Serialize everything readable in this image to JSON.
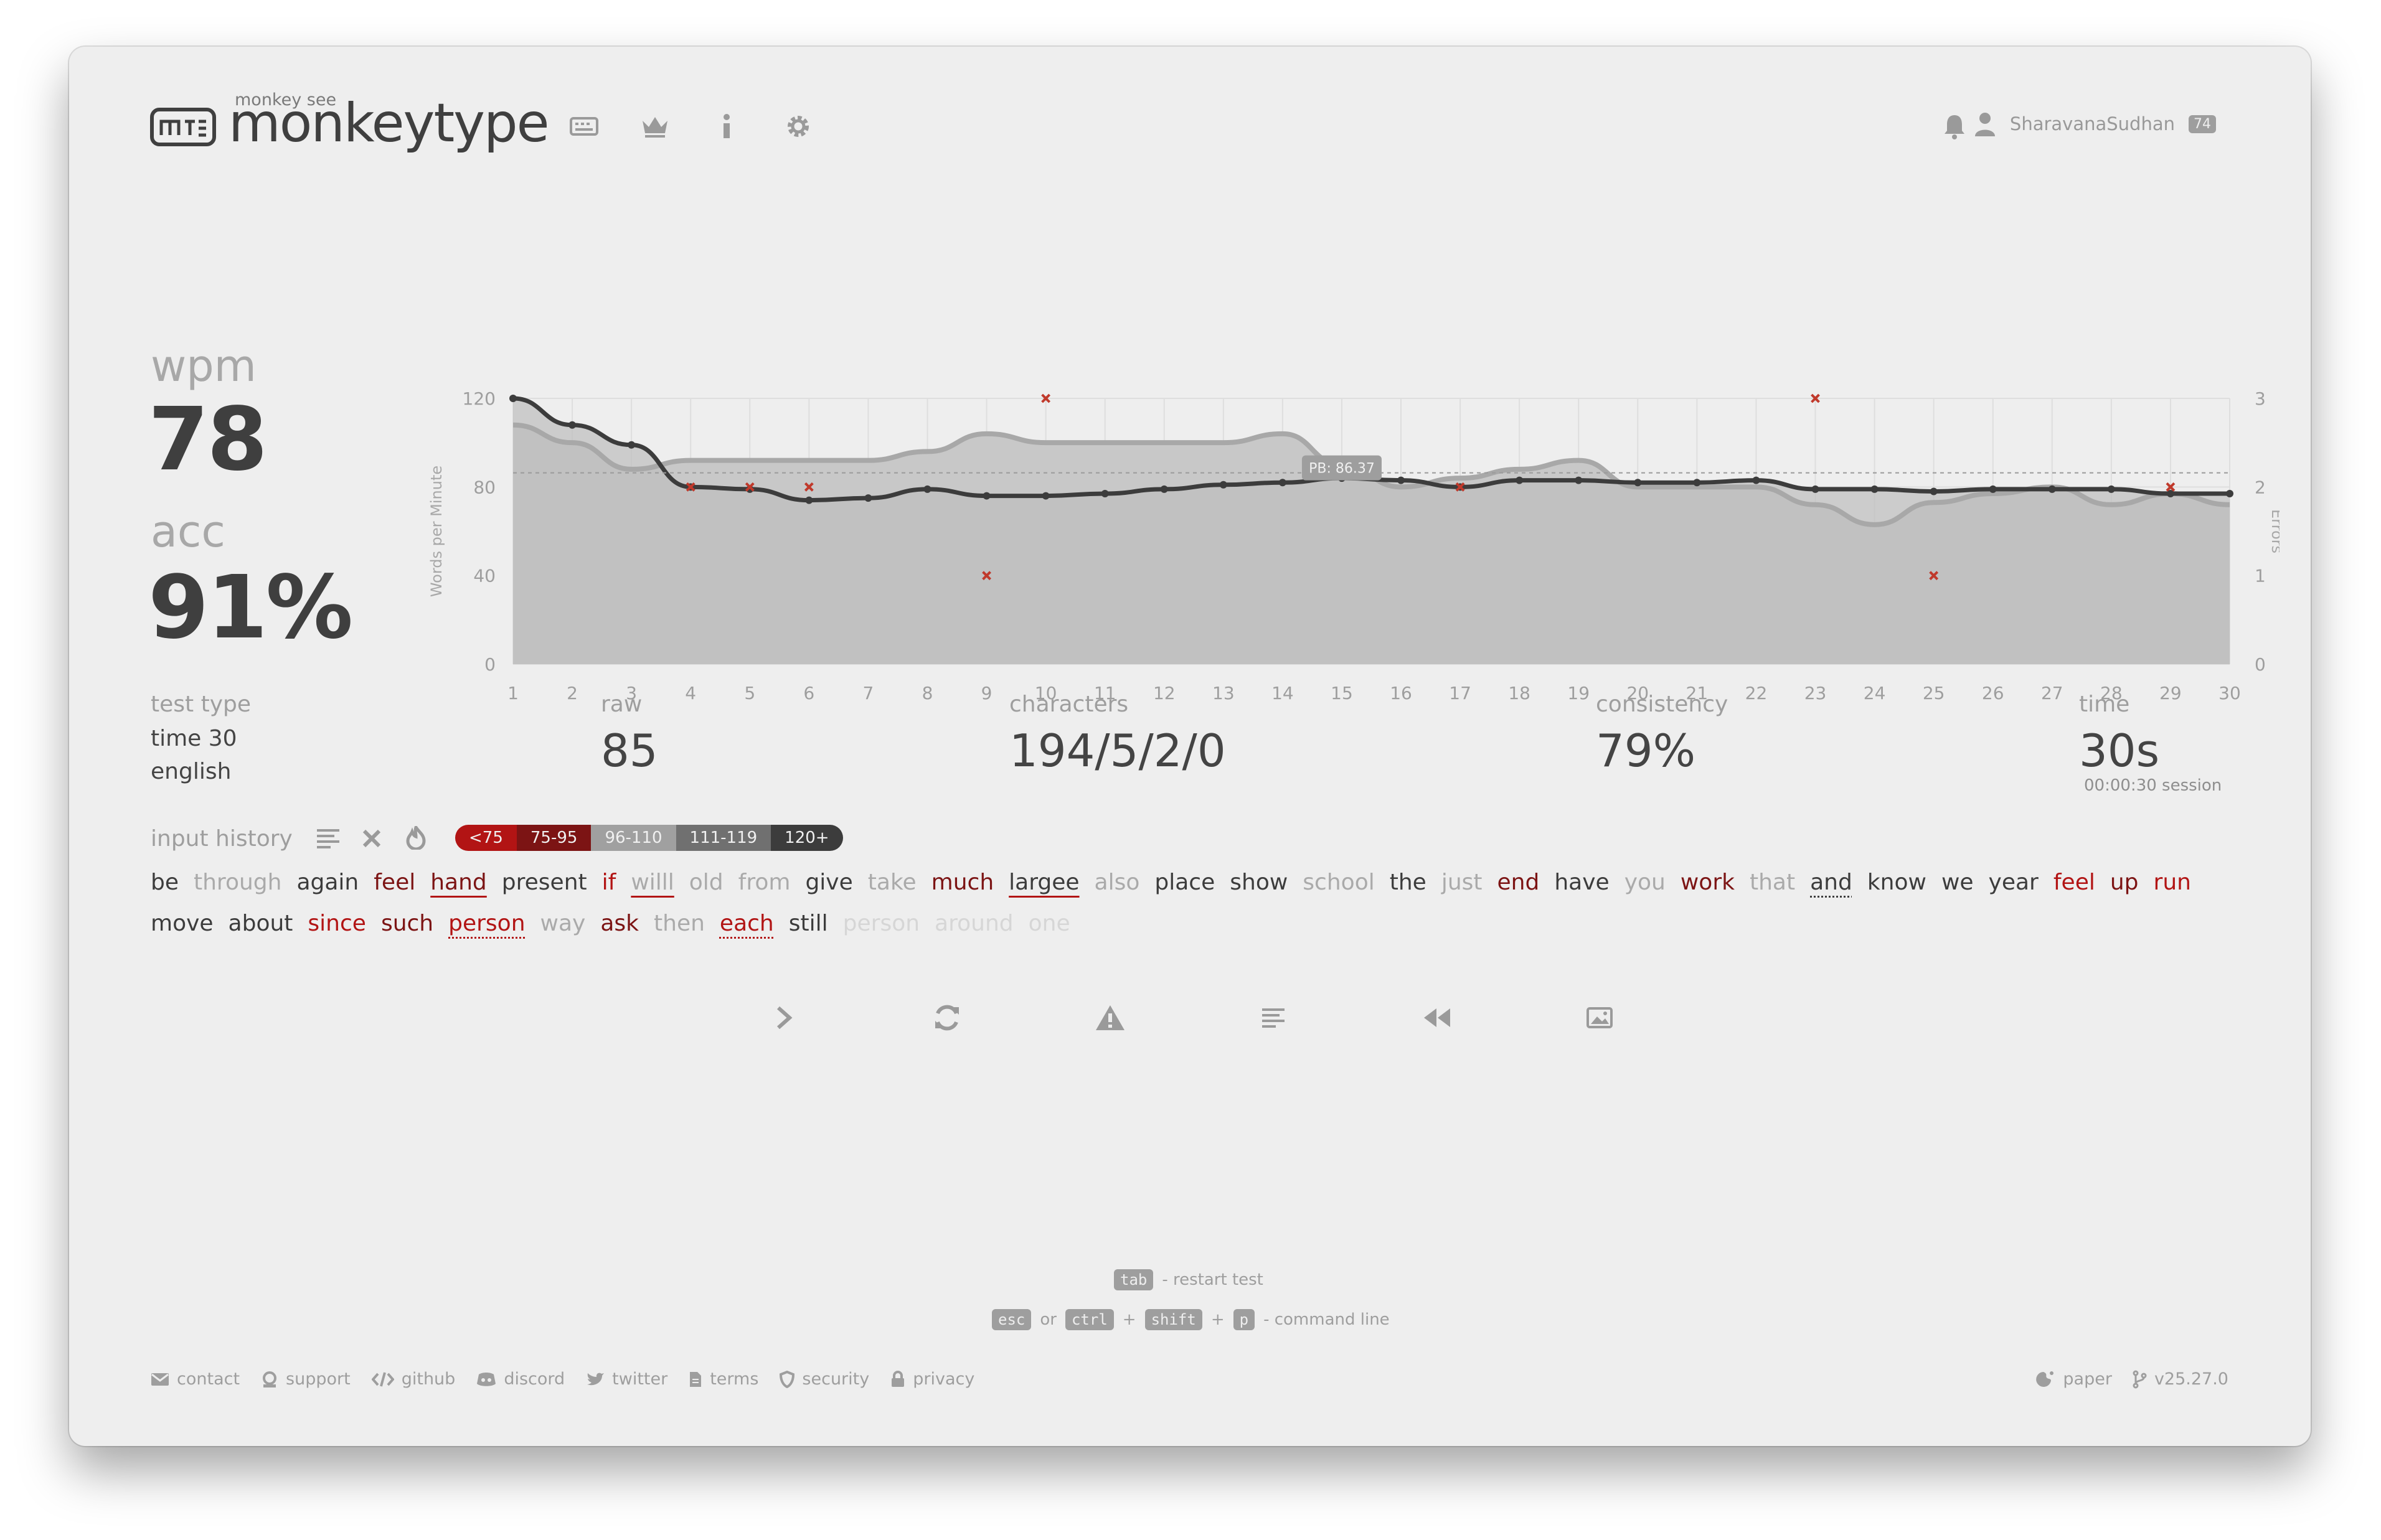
{
  "header": {
    "logo_subtitle": "monkey see",
    "logo_text": "monkeytype",
    "username": "SharavanaSudhan",
    "level": "74"
  },
  "stats": {
    "wpm_label": "wpm",
    "wpm_value": "78",
    "acc_label": "acc",
    "acc_value": "91%",
    "test_type_label": "test type",
    "test_type_line1": "time 30",
    "test_type_line2": "english",
    "raw_label": "raw",
    "raw_value": "85",
    "characters_label": "characters",
    "characters_value": "194/5/2/0",
    "consistency_label": "consistency",
    "consistency_value": "79%",
    "time_label": "time",
    "time_value": "30s",
    "session_value": "00:00:30 session"
  },
  "chart_data": {
    "type": "line",
    "x": [
      1,
      2,
      3,
      4,
      5,
      6,
      7,
      8,
      9,
      10,
      11,
      12,
      13,
      14,
      15,
      16,
      17,
      18,
      19,
      20,
      21,
      22,
      23,
      24,
      25,
      26,
      27,
      28,
      29,
      30
    ],
    "series": [
      {
        "values": [
          120,
          108,
          99,
          80,
          79,
          74,
          75,
          79,
          76,
          76,
          77,
          79,
          81,
          82,
          84,
          83,
          80,
          83,
          83,
          82,
          82,
          83,
          79,
          79,
          78,
          79,
          79,
          79,
          77,
          77
        ]
      },
      {
        "values": [
          108,
          100,
          88,
          92,
          92,
          92,
          92,
          96,
          104,
          100,
          100,
          100,
          100,
          104,
          90,
          80,
          84,
          88,
          92,
          80,
          80,
          80,
          72,
          63,
          73,
          77,
          80,
          72,
          77,
          72
        ]
      }
    ],
    "errors": [
      {
        "x": 4,
        "count": 2
      },
      {
        "x": 5,
        "count": 2
      },
      {
        "x": 6,
        "count": 2
      },
      {
        "x": 9,
        "count": 1
      },
      {
        "x": 10,
        "count": 3
      },
      {
        "x": 17,
        "count": 2
      },
      {
        "x": 23,
        "count": 3
      },
      {
        "x": 25,
        "count": 1
      },
      {
        "x": 29,
        "count": 2
      }
    ],
    "pb_value": 86.37,
    "pb_label": "PB: 86.37",
    "ylabel": "Words per Minute",
    "y2label": "Errors",
    "ylim": [
      0,
      120
    ],
    "y2lim": [
      0,
      3
    ],
    "y_ticks": [
      "0",
      "40",
      "80",
      "120"
    ],
    "y2_ticks": [
      "0",
      "1",
      "2",
      "3"
    ],
    "grid": true,
    "colors": {
      "wpm": "#3c3c3c",
      "raw": "#a8a8a8",
      "fill": "#c8c8c8",
      "error": "#c0392b"
    }
  },
  "input_history": {
    "label": "input history",
    "legend": [
      {
        "label": "<75",
        "bg": "#b21414",
        "fg": "#f0f0f0"
      },
      {
        "label": "75-95",
        "bg": "#7c1414",
        "fg": "#f0f0f0"
      },
      {
        "label": "96-110",
        "bg": "#a0a0a0",
        "fg": "#f0f0f0"
      },
      {
        "label": "111-119",
        "bg": "#707070",
        "fg": "#f0f0f0"
      },
      {
        "label": "120+",
        "bg": "#3c3c3c",
        "fg": "#f0f0f0"
      }
    ],
    "words": [
      {
        "t": "be",
        "c": "dark"
      },
      {
        "t": "through",
        "c": "light"
      },
      {
        "t": "again",
        "c": "dark"
      },
      {
        "t": "feel",
        "c": "dred"
      },
      {
        "t": "hand",
        "c": "dred",
        "u": "red"
      },
      {
        "t": "present",
        "c": "dark"
      },
      {
        "t": "if",
        "c": "red"
      },
      {
        "t": "willl",
        "c": "light",
        "u": "red"
      },
      {
        "t": "old",
        "c": "light"
      },
      {
        "t": "from",
        "c": "light"
      },
      {
        "t": "give",
        "c": "dark"
      },
      {
        "t": "take",
        "c": "light"
      },
      {
        "t": "much",
        "c": "dred"
      },
      {
        "t": "largee",
        "c": "dark",
        "u": "red"
      },
      {
        "t": "also",
        "c": "light"
      },
      {
        "t": "place",
        "c": "dark"
      },
      {
        "t": "show",
        "c": "dark"
      },
      {
        "t": "school",
        "c": "light"
      },
      {
        "t": "the",
        "c": "dark"
      },
      {
        "t": "just",
        "c": "light"
      },
      {
        "t": "end",
        "c": "dred"
      },
      {
        "t": "have",
        "c": "dark"
      },
      {
        "t": "you",
        "c": "light"
      },
      {
        "t": "work",
        "c": "dred"
      },
      {
        "t": "that",
        "c": "light"
      },
      {
        "t": "and",
        "c": "dark",
        "u": "dot"
      },
      {
        "t": "know",
        "c": "dark"
      },
      {
        "t": "we",
        "c": "dark"
      },
      {
        "t": "year",
        "c": "dark"
      },
      {
        "t": "feel",
        "c": "red"
      },
      {
        "t": "up",
        "c": "dred"
      },
      {
        "t": "run",
        "c": "red"
      },
      {
        "t": "move",
        "c": "dark"
      },
      {
        "t": "about",
        "c": "dark"
      },
      {
        "t": "since",
        "c": "red"
      },
      {
        "t": "such",
        "c": "dred"
      },
      {
        "t": "person",
        "c": "red",
        "u": "dot"
      },
      {
        "t": "way",
        "c": "light"
      },
      {
        "t": "ask",
        "c": "dred"
      },
      {
        "t": "then",
        "c": "light"
      },
      {
        "t": "each",
        "c": "red",
        "u": "dot"
      },
      {
        "t": "still",
        "c": "dark"
      },
      {
        "t": "person",
        "c": "faint"
      },
      {
        "t": "around",
        "c": "faint"
      },
      {
        "t": "one",
        "c": "faint"
      }
    ]
  },
  "hints": {
    "tab_key": "tab",
    "restart_text": "- restart test",
    "esc_key": "esc",
    "or_text": "or",
    "ctrl_key": "ctrl",
    "plus": "+",
    "shift_key": "shift",
    "p_key": "p",
    "command_text": "- command line"
  },
  "footer": {
    "links": [
      "contact",
      "support",
      "github",
      "discord",
      "twitter",
      "terms",
      "security",
      "privacy"
    ],
    "theme": "paper",
    "version": "v25.27.0"
  }
}
